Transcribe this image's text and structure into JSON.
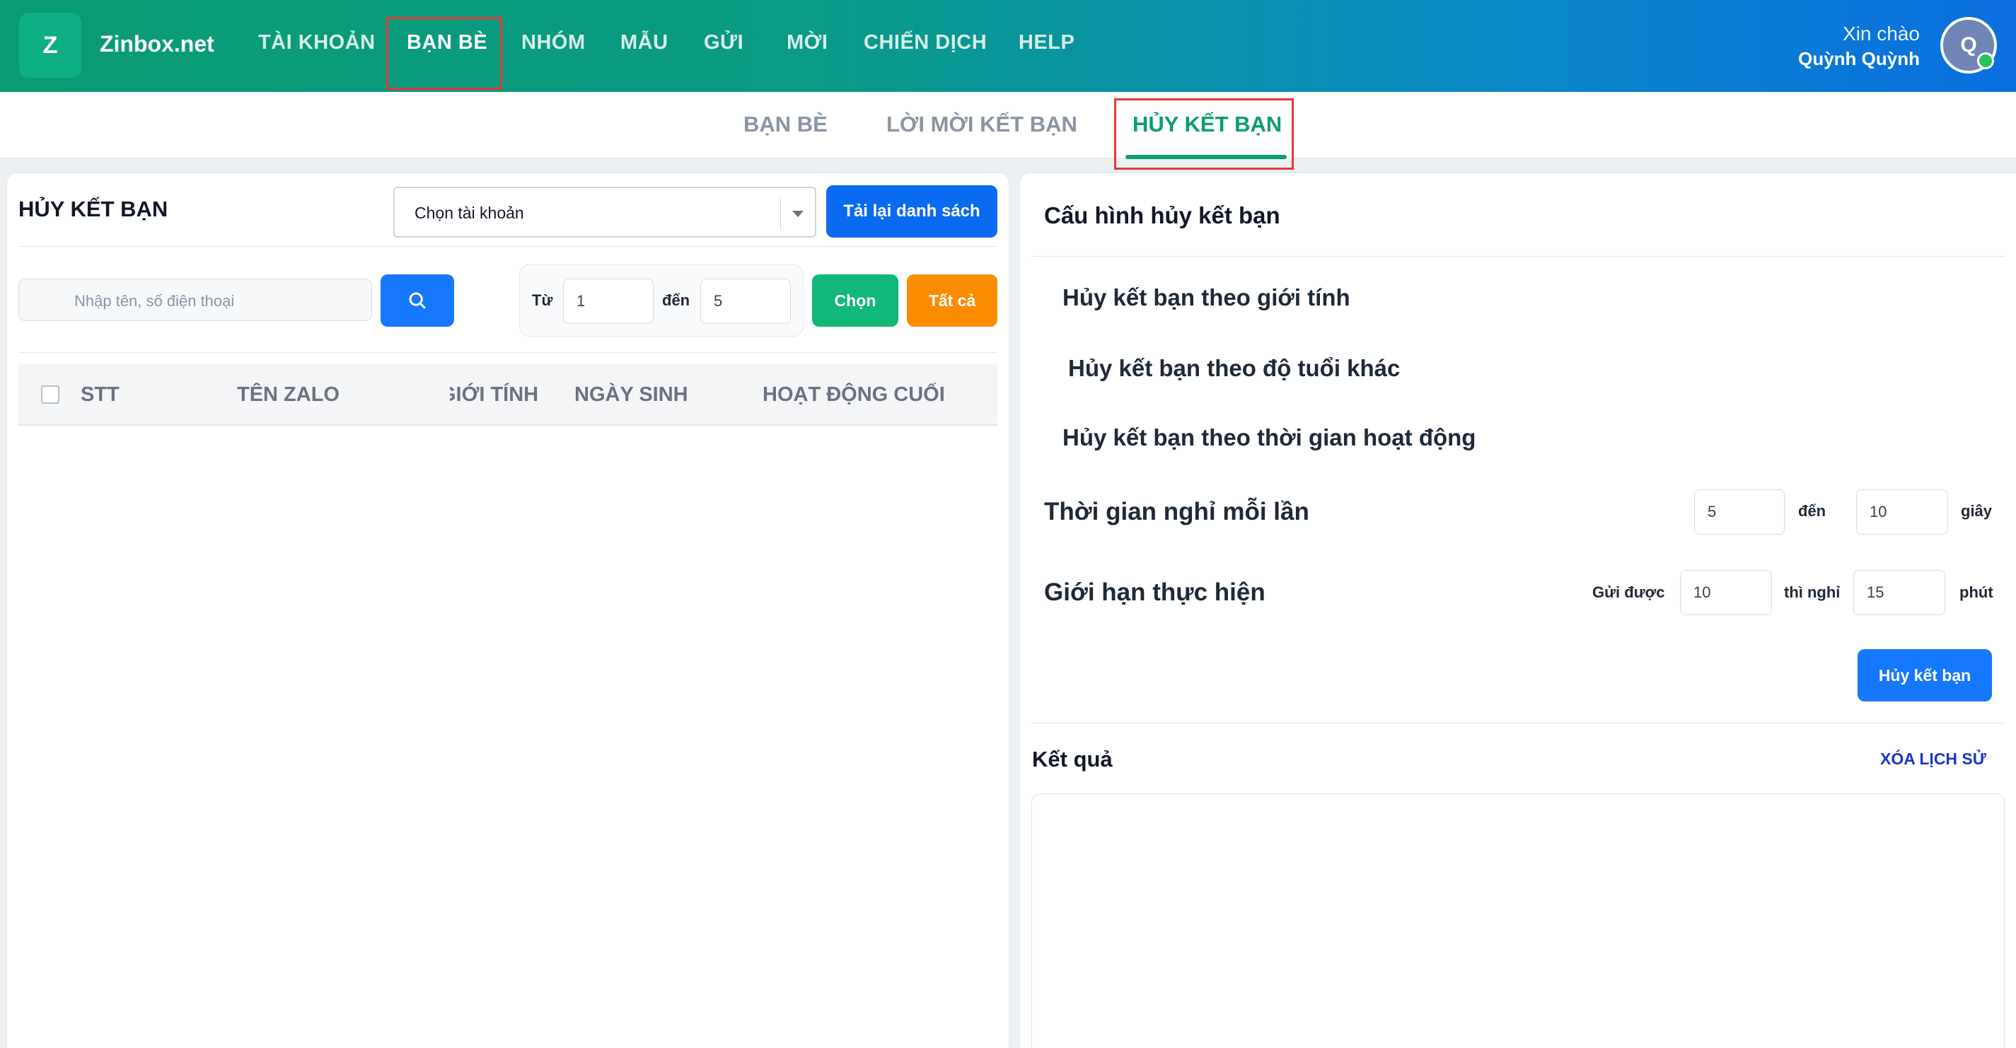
{
  "header": {
    "logo_letter": "Z",
    "brand": "Zinbox.net",
    "nav": [
      "TÀI KHOẢN",
      "BẠN BÈ",
      "NHÓM",
      "MẪU",
      "GỬI",
      "MỜI",
      "CHIẾN DỊCH",
      "HELP"
    ],
    "active_nav": "BẠN BÈ",
    "greeting": "Xin chào",
    "user_name": "Quỳnh Quỳnh",
    "avatar_letter": "Q"
  },
  "subtabs": {
    "items": [
      "BẠN BÈ",
      "LỜI MỜI KẾT BẠN",
      "HỦY KẾT BẠN"
    ],
    "active": "HỦY KẾT BẠN"
  },
  "left": {
    "title": "HỦY KẾT BẠN",
    "account_select": "Chọn tài khoản",
    "reload_button": "Tải lại danh sách",
    "search_placeholder": "Nhập tên, số điện thoại",
    "range_from_label": "Từ",
    "range_from": "1",
    "range_to_label": "đến",
    "range_to": "5",
    "select_button": "Chọn",
    "all_button": "Tất cả",
    "columns": [
      "STT",
      "TÊN ZALO",
      "GIỚI TÍNH",
      "NGÀY SINH",
      "HOẠT ĐỘNG CUỐI"
    ]
  },
  "right": {
    "title": "Cấu hình hủy kết bạn",
    "options": [
      "Hủy kết bạn theo giới tính",
      "Hủy kết bạn theo độ tuổi khác",
      "Hủy kết bạn theo thời gian hoạt động"
    ],
    "rest_label": "Thời gian nghỉ mỗi lần",
    "rest_from": "5",
    "rest_to_label": "đến",
    "rest_to": "10",
    "rest_unit": "giây",
    "limit_label": "Giới hạn thực hiện",
    "limit_send_label": "Gửi được",
    "limit_send": "10",
    "limit_rest_label": "thì nghỉ",
    "limit_rest": "15",
    "limit_unit": "phút",
    "submit_button": "Hủy kết bạn",
    "result_title": "Kết quả",
    "clear_history": "XÓA LỊCH SỬ"
  },
  "colors": {
    "nav_gradient_start": "#0a9b72",
    "nav_gradient_end": "#0a6fe0",
    "active_tab": "#0a9e6f",
    "primary_button": "#1677ff",
    "success_button": "#12b77a",
    "warning_button": "#fb8c00",
    "highlight_box": "#e53935"
  }
}
